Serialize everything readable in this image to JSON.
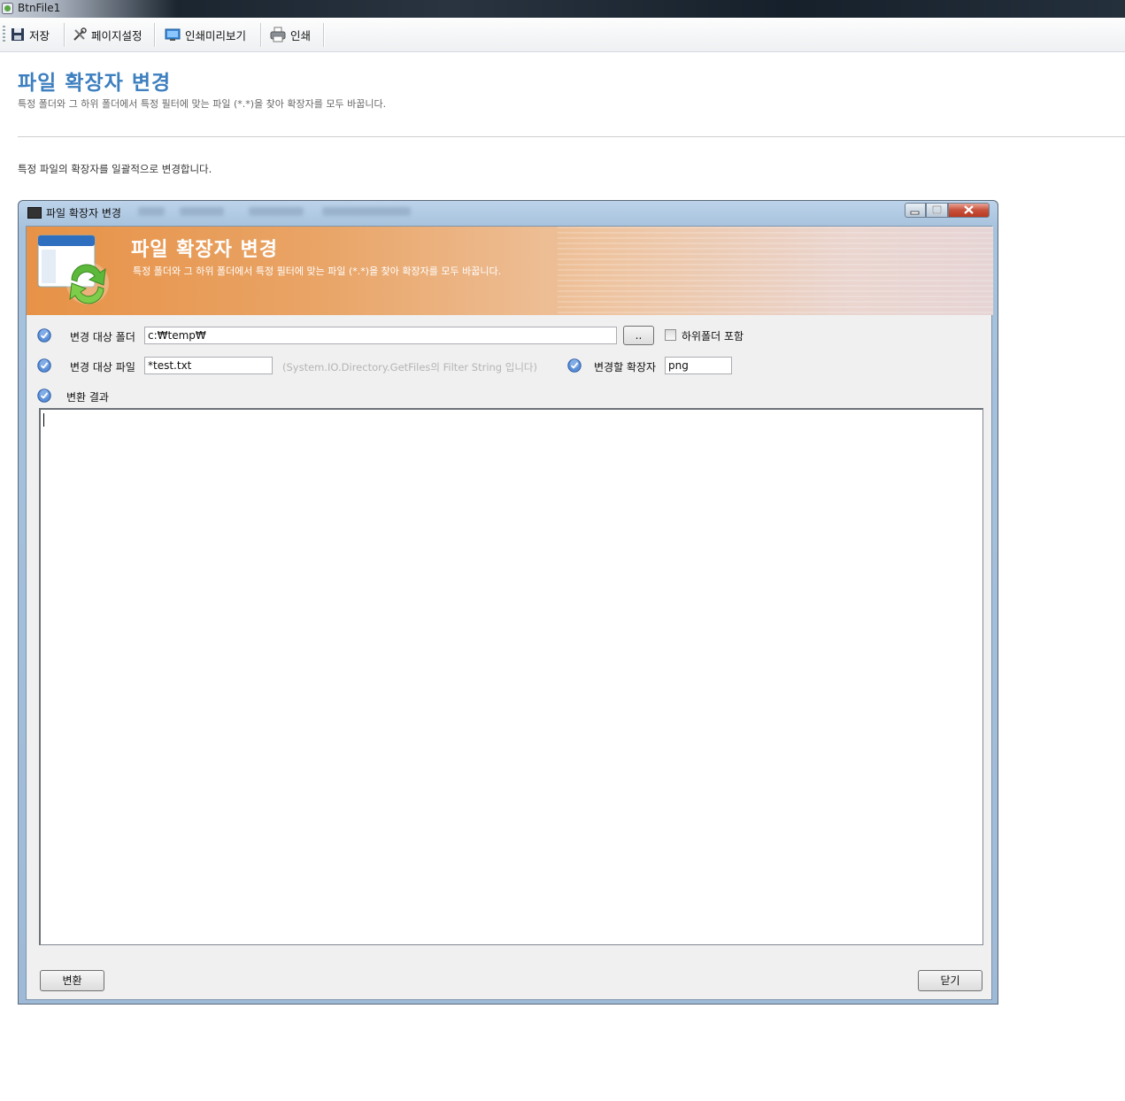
{
  "app": {
    "title": "BtnFile1"
  },
  "toolbar": {
    "save": "저장",
    "page_setup": "페이지설정",
    "print_preview": "인쇄미리보기",
    "print": "인쇄"
  },
  "page": {
    "title": "파일 확장자 변경",
    "subtitle": "특정 폴더와 그 하위 폴더에서 특정 필터에 맞는 파일 (*.*)을 찾아 확장자를 모두 바꿉니다.",
    "description": "특정 파일의 확장자를 일괄적으로 변경합니다."
  },
  "dialog": {
    "title": "파일 확장자 변경",
    "banner_title": "파일 확장자 변경",
    "banner_subtitle": "특정 폴더와 그 하위 폴더에서 특정 필터에 맞는 파일 (*.*)을 찾아 확장자를 모두 바꿉니다.",
    "folder_label": "변경 대상 폴더",
    "folder_value": "c:₩temp₩",
    "browse_label": "..",
    "include_subfolders_label": "하위폴더 포함",
    "include_subfolders_checked": false,
    "file_label": "변경 대상 파일",
    "file_value": "*test.txt",
    "file_hint": "(System.IO.Directory.GetFiles의 Filter String 입니다)",
    "ext_label": "변경할 확장자",
    "ext_value": "png",
    "result_label": "변환 결과",
    "result_value": "",
    "convert_button": "변환",
    "close_button": "닫기"
  }
}
